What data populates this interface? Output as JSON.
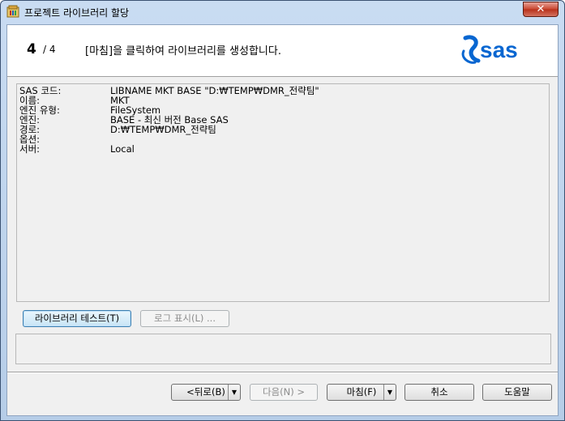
{
  "window": {
    "title": "프로젝트 라이브러리 할당",
    "close_label": "✕"
  },
  "header": {
    "step_current": "4",
    "step_total": "/ 4",
    "instruction": "[마침]을 클릭하여 라이브러리를 생성합니다.",
    "logo_text": "sas",
    "brand_color": "#0766d1"
  },
  "info": {
    "rows": [
      {
        "label": "SAS 코드:",
        "value": "LIBNAME MKT BASE \"D:₩TEMP₩DMR_전략팀\""
      },
      {
        "label": "이름:",
        "value": "MKT"
      },
      {
        "label": "엔진 유형:",
        "value": "FileSystem"
      },
      {
        "label": "엔진:",
        "value": "BASE - 최신 버전 Base SAS"
      },
      {
        "label": "경로:",
        "value": "D:₩TEMP₩DMR_전략팀"
      },
      {
        "label": "옵션:",
        "value": ""
      },
      {
        "label": "서버:",
        "value": "Local"
      }
    ]
  },
  "actions": {
    "test_library": "라이브러리 테스트(T)",
    "show_log": "로그 표시(L) ..."
  },
  "footer": {
    "back": "<뒤로(B)",
    "next": "다음(N) >",
    "finish": "마침(F)",
    "cancel": "취소",
    "help": "도움말",
    "dropdown_arrow": "▼"
  }
}
